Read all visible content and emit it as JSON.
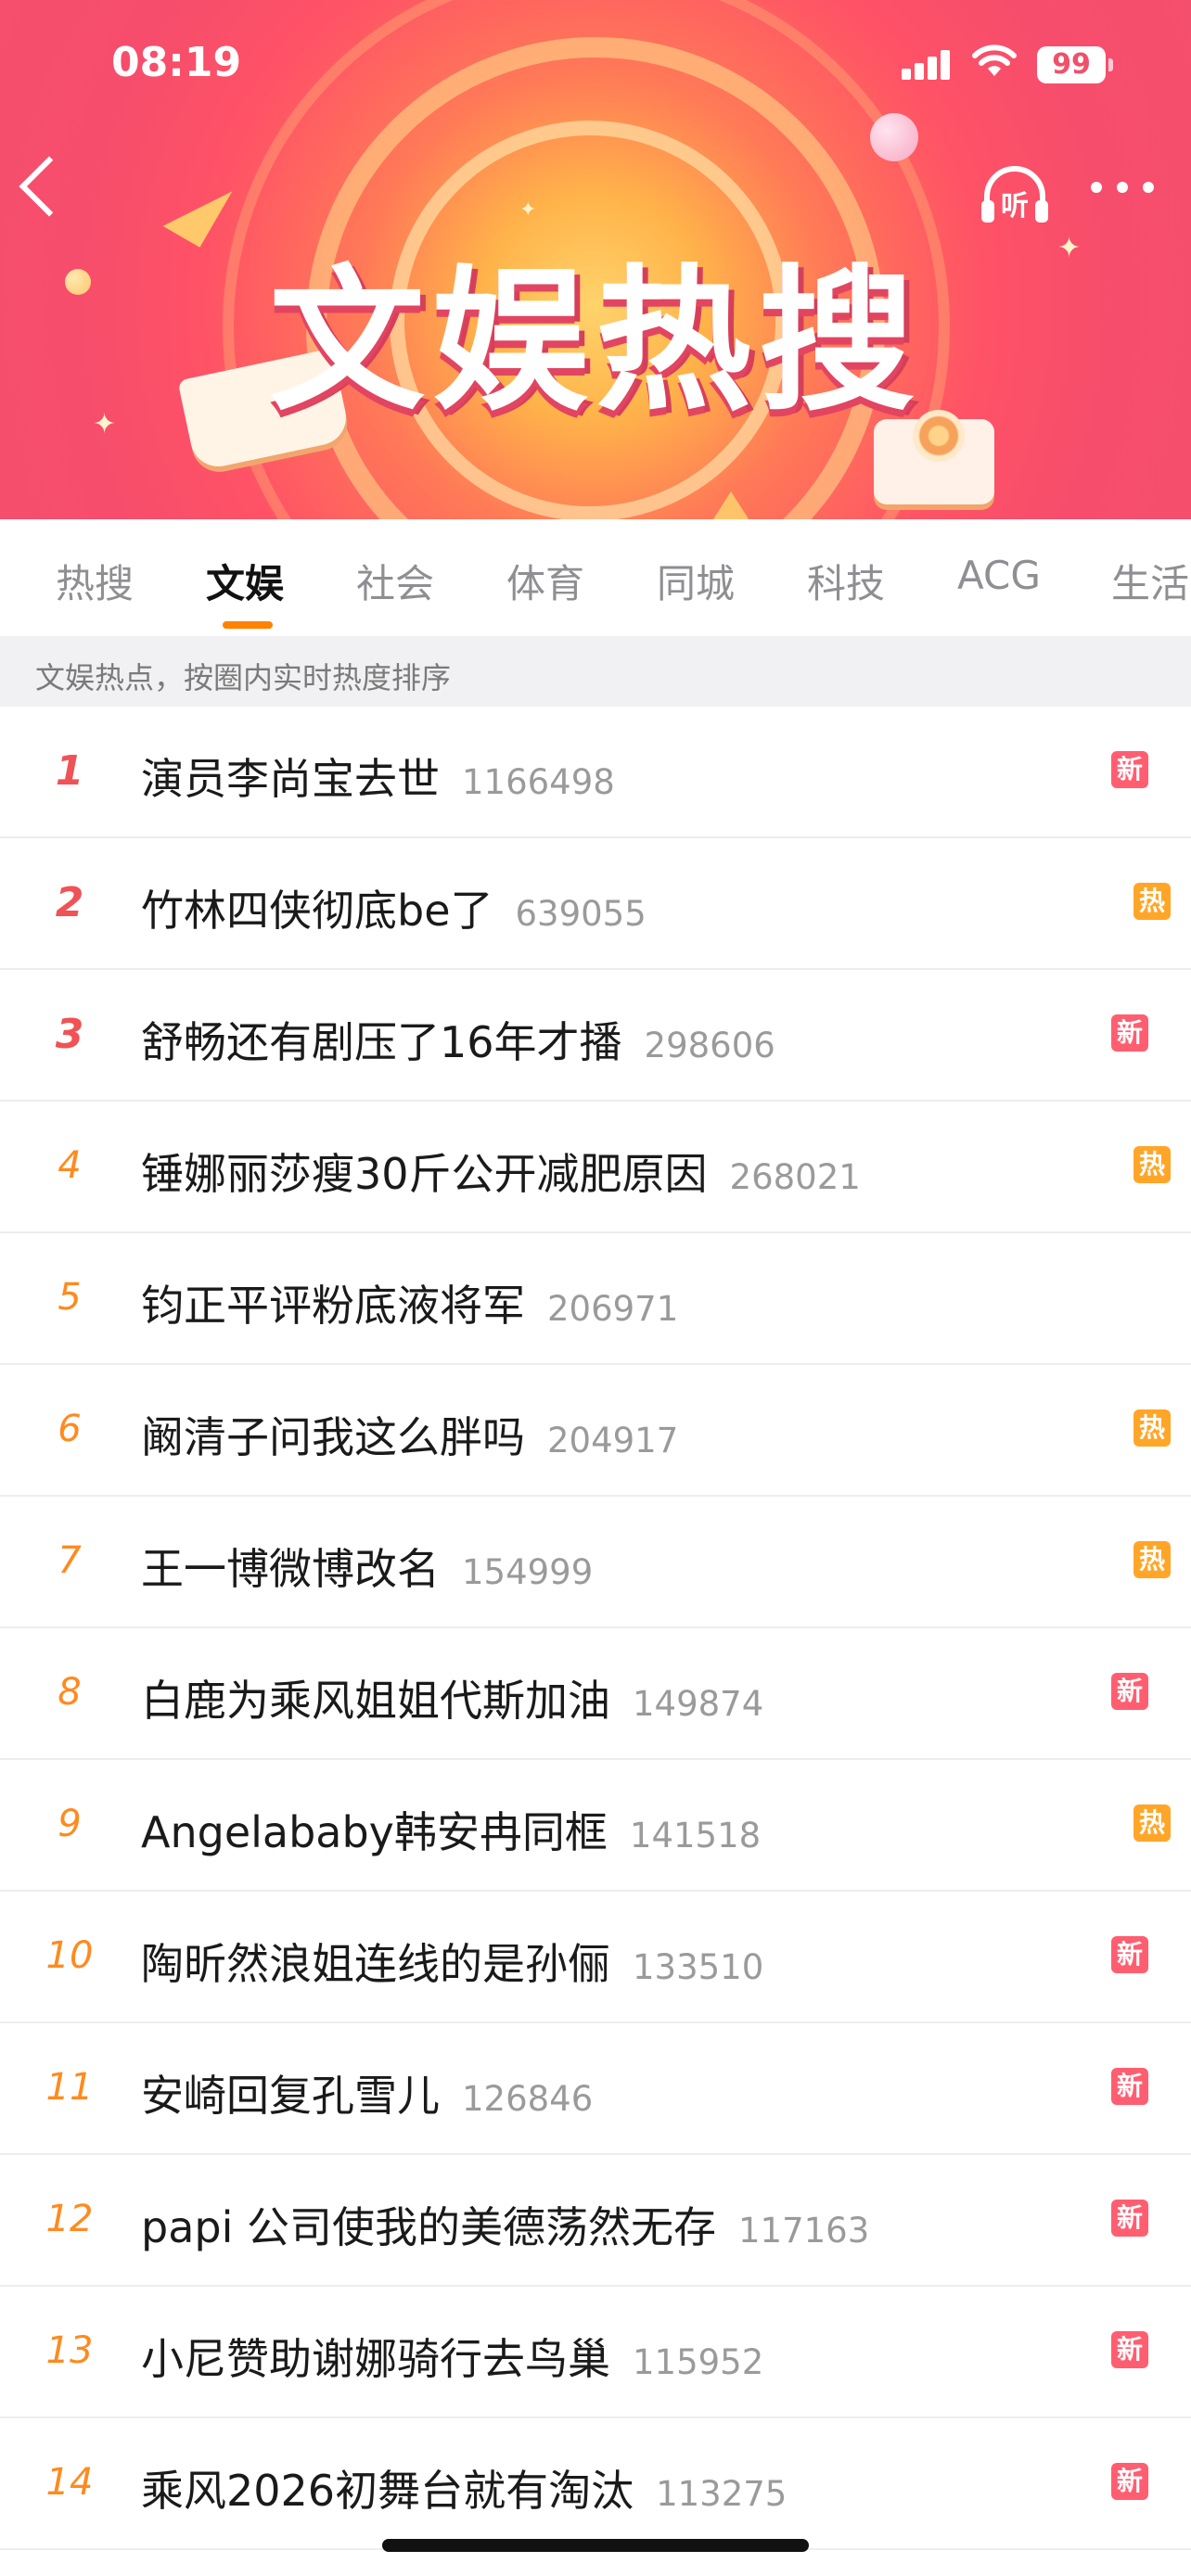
{
  "status_bar": {
    "time": "08:19",
    "battery": "99"
  },
  "banner": {
    "title": "文娱热搜",
    "listen_icon_text": "听"
  },
  "tabs": [
    {
      "label": "热搜"
    },
    {
      "label": "文娱"
    },
    {
      "label": "社会"
    },
    {
      "label": "体育"
    },
    {
      "label": "同城"
    },
    {
      "label": "科技"
    },
    {
      "label": "ACG"
    },
    {
      "label": "生活"
    }
  ],
  "active_tab": "文娱",
  "hint": "文娱热点，按圈内实时热度排序",
  "items": [
    {
      "rank": "1",
      "title": "演员李尚宝去世",
      "heat": "1166498",
      "badge": "新"
    },
    {
      "rank": "2",
      "title": "竹林四侠彻底be了",
      "heat": "639055",
      "badge": "热"
    },
    {
      "rank": "3",
      "title": "舒畅还有剧压了16年才播",
      "heat": "298606",
      "badge": "新"
    },
    {
      "rank": "4",
      "title": "锤娜丽莎瘦30斤公开减肥原因",
      "heat": "268021",
      "badge": "热"
    },
    {
      "rank": "5",
      "title": "钧正平评粉底液将军",
      "heat": "206971",
      "badge": ""
    },
    {
      "rank": "6",
      "title": "阚清子问我这么胖吗",
      "heat": "204917",
      "badge": "热"
    },
    {
      "rank": "7",
      "title": "王一博微博改名",
      "heat": "154999",
      "badge": "热"
    },
    {
      "rank": "8",
      "title": "白鹿为乘风姐姐代斯加油",
      "heat": "149874",
      "badge": "新"
    },
    {
      "rank": "9",
      "title": "Angelababy韩安冉同框",
      "heat": "141518",
      "badge": "热"
    },
    {
      "rank": "10",
      "title": "陶昕然浪姐连线的是孙俪",
      "heat": "133510",
      "badge": "新"
    },
    {
      "rank": "11",
      "title": "安崎回复孔雪儿",
      "heat": "126846",
      "badge": "新"
    },
    {
      "rank": "12",
      "title": "papi 公司使我的美德荡然无存",
      "heat": "117163",
      "badge": "新"
    },
    {
      "rank": "13",
      "title": "小尼赞助谢娜骑行去鸟巢",
      "heat": "115952",
      "badge": "新"
    },
    {
      "rank": "14",
      "title": "乘风2026初舞台就有淘汰",
      "heat": "113275",
      "badge": "新"
    }
  ],
  "colors": {
    "accent": "#ff8200",
    "rank_top": "#f05256",
    "rank": "#ff8a1e",
    "badge_new": "#ff5e71",
    "badge_hot": "#ffa629"
  }
}
